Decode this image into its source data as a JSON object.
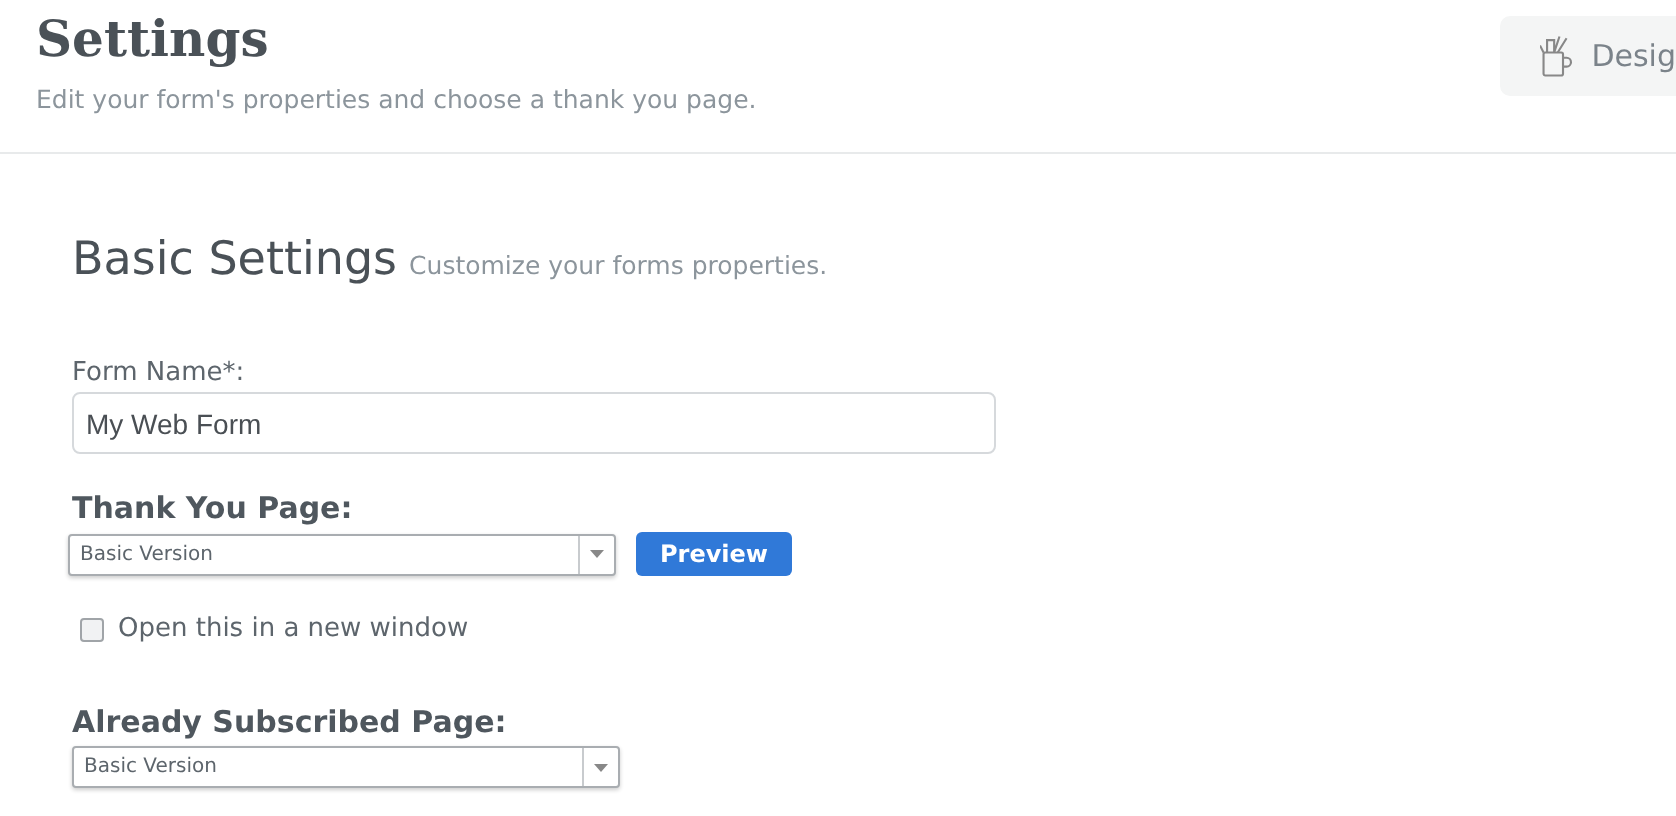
{
  "header": {
    "title": "Settings",
    "subtitle": "Edit your form's properties and choose a thank you page.",
    "design_button": "Desig"
  },
  "section": {
    "title": "Basic Settings",
    "subtitle": "Customize your forms properties."
  },
  "form_name": {
    "label": "Form Name*:",
    "value": "My Web Form"
  },
  "thank_you": {
    "label": "Thank You Page:",
    "value": "Basic Version",
    "preview": "Preview",
    "new_window": {
      "label": "Open this in a new window",
      "checked": false
    }
  },
  "already_subscribed": {
    "label": "Already Subscribed Page:",
    "value": "Basic Version"
  }
}
